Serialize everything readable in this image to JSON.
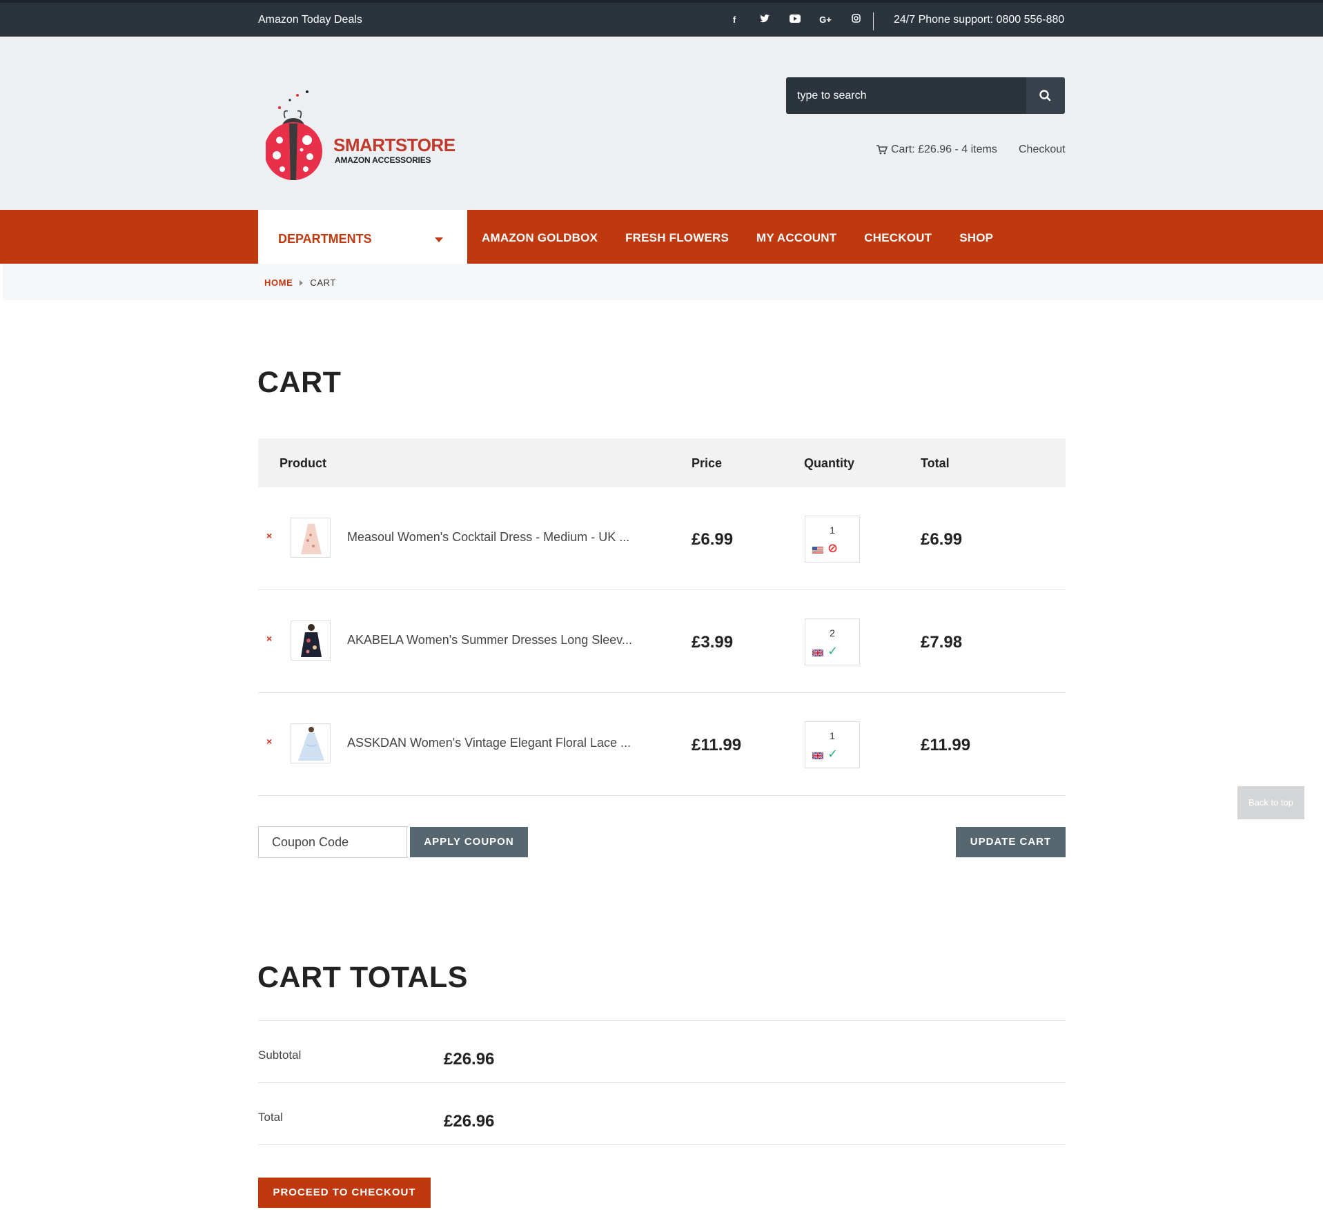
{
  "topbar": {
    "deals": "Amazon Today Deals",
    "social": [
      {
        "name": "facebook-icon",
        "glyph": "f"
      },
      {
        "name": "twitter-icon",
        "glyph": "t"
      },
      {
        "name": "youtube-icon",
        "glyph": "▶"
      },
      {
        "name": "google-plus-icon",
        "glyph": "G+"
      },
      {
        "name": "instagram-icon",
        "glyph": "◎"
      }
    ],
    "phone": "24/7 Phone support: 0800 556-880"
  },
  "header": {
    "brand": "SMARTSTORE",
    "brand_sub": "AMAZON ACCESSORIES",
    "search_placeholder": "type to search",
    "cart": "Cart: £26.96 - 4 items",
    "checkout": "Checkout"
  },
  "nav": {
    "departments": "DEPARTMENTS",
    "items": [
      "AMAZON GOLDBOX",
      "FRESH FLOWERS",
      "MY ACCOUNT",
      "CHECKOUT",
      "SHOP"
    ]
  },
  "breadcrumb": {
    "home": "HOME",
    "current": "CART"
  },
  "cart": {
    "title": "CART",
    "headers": {
      "product": "Product",
      "price": "Price",
      "quantity": "Quantity",
      "total": "Total"
    },
    "items": [
      {
        "remove": "×",
        "name": "Measoul Women's Cocktail Dress - Medium - UK ...",
        "price": "£6.99",
        "qty": "1",
        "flag": "us",
        "status": "⊘",
        "status_color": "#e03131",
        "total": "£6.99"
      },
      {
        "remove": "×",
        "name": "AKABELA Women's Summer Dresses Long Sleev...",
        "price": "£3.99",
        "qty": "2",
        "flag": "uk",
        "status": "✓",
        "status_color": "#22b573",
        "total": "£7.98"
      },
      {
        "remove": "×",
        "name": "ASSKDAN Women's Vintage Elegant Floral Lace ...",
        "price": "£11.99",
        "qty": "1",
        "flag": "uk",
        "status": "✓",
        "status_color": "#22b573",
        "total": "£11.99"
      }
    ],
    "coupon_placeholder": "Coupon Code",
    "apply_coupon": "APPLY COUPON",
    "update_cart": "UPDATE CART",
    "back_to_top": "Back to top"
  },
  "totals": {
    "title": "CART TOTALS",
    "subtotal_label": "Subtotal",
    "subtotal_value": "£26.96",
    "total_label": "Total",
    "total_value": "£26.96",
    "proceed": "PROCEED TO CHECKOUT"
  },
  "colors": {
    "accent": "#c0380e",
    "dark": "#2b333c",
    "button": "#56676f"
  }
}
